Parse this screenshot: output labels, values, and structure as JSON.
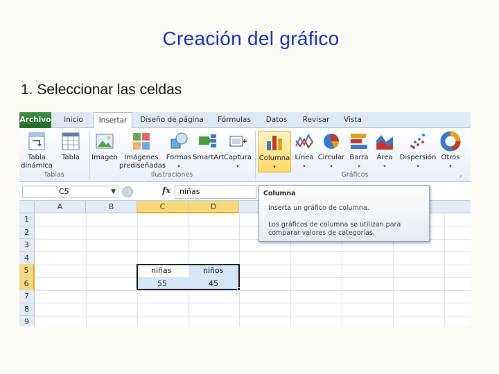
{
  "slide": {
    "title": "Creación del gráfico",
    "bullet": "1. Seleccionar las celdas"
  },
  "tabs": [
    "Archivo",
    "Inicio",
    "Insertar",
    "Diseño de página",
    "Fórmulas",
    "Datos",
    "Revisar",
    "Vista"
  ],
  "active_tab": "Insertar",
  "ribbon": {
    "tablas": {
      "group_label": "Tablas",
      "buttons": [
        "Tabla dinámica",
        "Tabla"
      ]
    },
    "ilustraciones": {
      "group_label": "Ilustraciones",
      "buttons": [
        "Imagen",
        "Imágenes prediseñadas",
        "Formas",
        "SmartArt",
        "Captura"
      ]
    },
    "graficos": {
      "group_label": "Gráficos",
      "buttons": [
        "Columna",
        "Línea",
        "Circular",
        "Barra",
        "Área",
        "Dispersión",
        "Otros"
      ]
    },
    "selected_button": "Columna"
  },
  "formula_bar": {
    "name_box": "C5",
    "fx": "fx",
    "value": "niñas"
  },
  "grid": {
    "columns": [
      "A",
      "B",
      "C",
      "D"
    ],
    "rows": [
      "1",
      "2",
      "3",
      "4",
      "5",
      "6",
      "7",
      "8",
      "9"
    ],
    "cells": {
      "C5": "niñas",
      "D5": "niños",
      "C6": "55",
      "D6": "45"
    },
    "selected_range": "C5:D6"
  },
  "tooltip": {
    "title": "Columna",
    "line1": "Inserta un gráfico de columna.",
    "line2": "Los gráficos de columna se utilizan para comparar valores de categorías."
  },
  "colors": {
    "title_blue": "#1a2bb8",
    "file_tab_green": "#2f7d35",
    "selection_header": "#f8d97a",
    "selection_fill": "#d6e6f7"
  }
}
